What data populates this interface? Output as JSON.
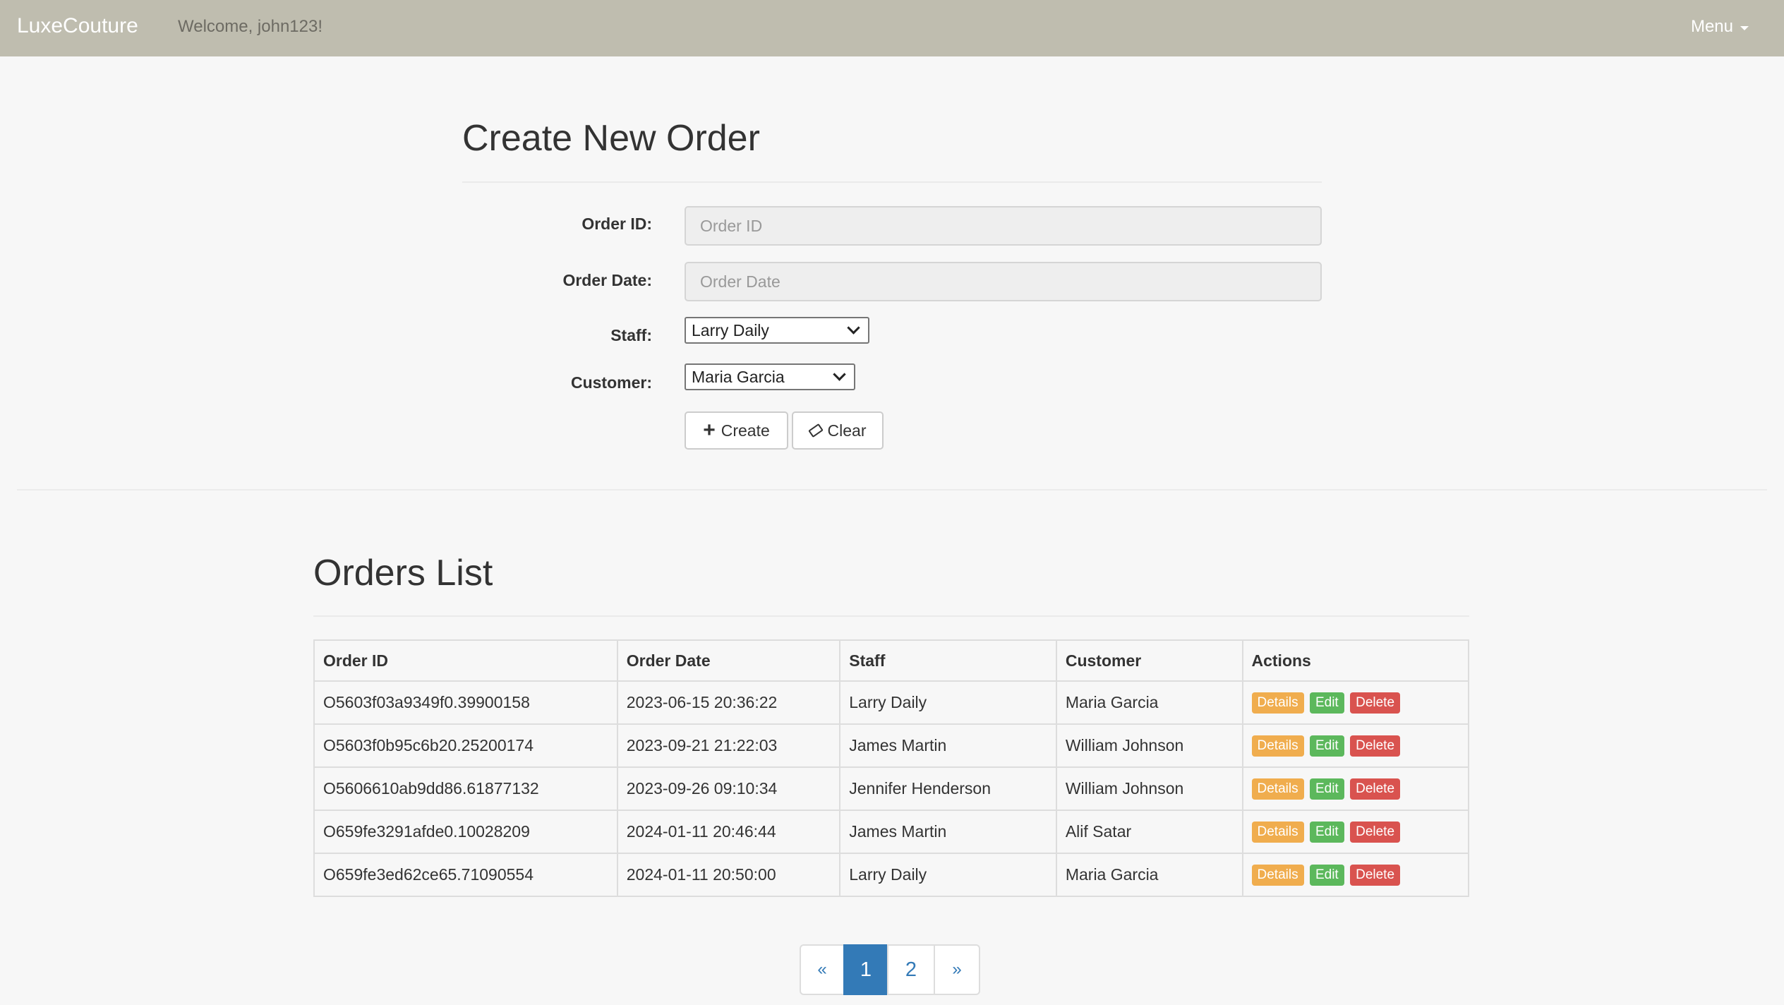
{
  "navbar": {
    "brand": "LuxeCouture",
    "welcome": "Welcome, john123!",
    "menu_label": "Menu"
  },
  "form": {
    "title": "Create New Order",
    "order_id_label": "Order ID:",
    "order_id_placeholder": "Order ID",
    "order_id_value": "",
    "order_date_label": "Order Date:",
    "order_date_placeholder": "Order Date",
    "order_date_value": "",
    "staff_label": "Staff:",
    "staff_selected": "Larry Daily",
    "customer_label": "Customer:",
    "customer_selected": "Maria Garcia",
    "create_label": "Create",
    "clear_label": "Clear"
  },
  "list": {
    "title": "Orders List",
    "headers": [
      "Order ID",
      "Order Date",
      "Staff",
      "Customer",
      "Actions"
    ],
    "actions": {
      "details": "Details",
      "edit": "Edit",
      "delete": "Delete"
    },
    "rows": [
      {
        "order_id": "O5603f03a9349f0.39900158",
        "order_date": "2023-06-15 20:36:22",
        "staff": "Larry Daily",
        "customer": "Maria Garcia"
      },
      {
        "order_id": "O5603f0b95c6b20.25200174",
        "order_date": "2023-09-21 21:22:03",
        "staff": "James Martin",
        "customer": "William Johnson"
      },
      {
        "order_id": "O5606610ab9dd86.61877132",
        "order_date": "2023-09-26 09:10:34",
        "staff": "Jennifer Henderson",
        "customer": "William Johnson"
      },
      {
        "order_id": "O659fe3291afde0.10028209",
        "order_date": "2024-01-11 20:46:44",
        "staff": "James Martin",
        "customer": "Alif Satar"
      },
      {
        "order_id": "O659fe3ed62ce65.71090554",
        "order_date": "2024-01-11 20:50:00",
        "staff": "Larry Daily",
        "customer": "Maria Garcia"
      }
    ]
  },
  "pagination": {
    "prev": "«",
    "pages": [
      "1",
      "2"
    ],
    "current": "1",
    "next": "»"
  },
  "colors": {
    "navbar": "#bfbdaf",
    "primary": "#337ab7",
    "details": "#f0ad4e",
    "edit": "#5cb85c",
    "delete": "#d9534f"
  },
  "icons": {
    "create": "plus-icon",
    "clear": "eraser-icon",
    "menu": "caret-down-icon",
    "select": "chevron-down-icon"
  }
}
